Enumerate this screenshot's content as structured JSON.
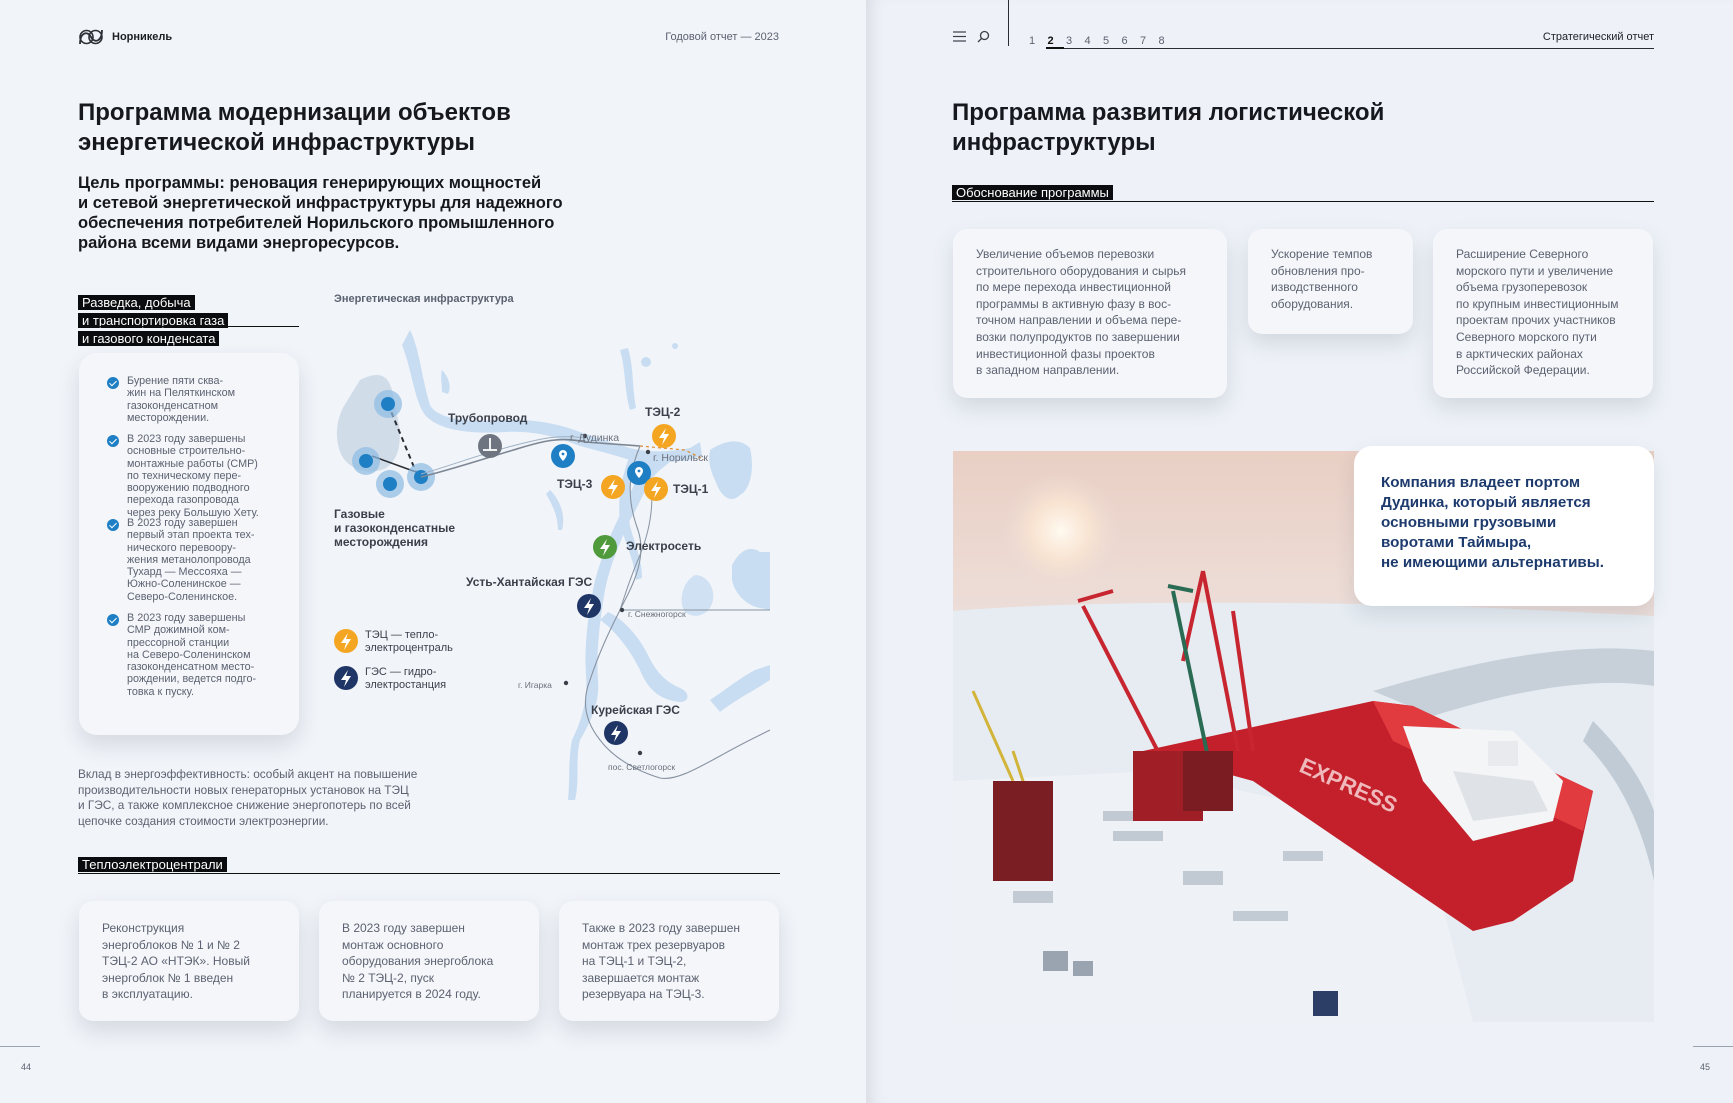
{
  "left": {
    "brand": "Норникель",
    "report_label": "Годовой отчет — 2023",
    "title": "Программа модернизации объектов\nэнергетической инфраструктуры",
    "goal": "Цель программы: реновация генерирующих мощностей\nи сетевой энергетической инфраструктуры для надежного\nобеспечения потребителей Норильского промышленного\nрайона всеми видами энергоресурсов.",
    "gas_section": {
      "tag": "Разведка, добыча\nи транспортировка газа\nи газового конденсата",
      "items": [
        "Бурение пяти сква-\nжин на Пеляткинском\nгазоконденсатном\nместорождении.",
        "В 2023 году завершены\nосновные строительно-\nмонтажные работы (СМР)\nпо техническому пере-\nвооружению подводного\nперехода газопровода\nчерез реку Большую Хету.",
        "В 2023 году завершен\nпервый этап проекта тех-\nнического перевоору-\nжения метанолопровода\nТухард — Мессояха —\nЮжно-Соленинское —\nСеверо-Соленинское.",
        "В 2023 году завершены\nСМР дожимной ком-\nпрессорной станции\nна Северо-Соленинском\nгазоконденсатном место-\nрождении, ведется подго-\nтовка к пуску."
      ]
    },
    "map": {
      "title": "Энергетическая инфраструктура",
      "labels": {
        "pipeline": "Трубопровод",
        "fields": "Газовые\nи газоконденсатные\nместорождения",
        "tec2": "ТЭЦ-2",
        "tec3": "ТЭЦ-3",
        "tec1": "ТЭЦ-1",
        "grid": "Электросеть",
        "ust": "Усть-Хантайская ГЭС",
        "kurei": "Курейская ГЭС"
      },
      "cities": {
        "dudinka": "г. Дудинка",
        "norilsk": "г. Норильск",
        "snezhnogorsk": "г. Снежногорск",
        "igarka": "г. Игарка",
        "svetlogorsk": "пос. Светлогорск"
      },
      "legend": {
        "tec": "ТЭЦ — тепло-\nэлектроцентраль",
        "ges": "ГЭС — гидро-\nэлектростанция"
      },
      "icons": {
        "tec": "lightning-icon",
        "ges": "lightning-icon",
        "city": "location-pin-icon",
        "pipeline": "pipeline-icon"
      },
      "colors": {
        "tec": "#f4a623",
        "ges": "#1f3566",
        "grid": "#4f9a3b",
        "pin": "#1f7fc4",
        "water": "#c9ddf2"
      }
    },
    "efficiency_note": "Вклад в энергоэффективность: особый акцент на повышение\nпроизводительности новых генераторных установок на ТЭЦ\nи ГЭС, а также комплексное снижение энергопотерь по всей\nцепочке создания стоимости электроэнергии.",
    "tec_section": {
      "tag": "Теплоэлектроцентрали",
      "cards": [
        "Реконструкция\nэнергоблоков № 1 и № 2\nТЭЦ-2 АО «НТЭК». Новый\nэнергоблок № 1 введен\nв эксплуатацию.",
        "В 2023 году завершен\nмонтаж основного\nоборудования энергоблока\n№ 2 ТЭЦ-2, пуск\nпланируется в 2024 году.",
        "Также в 2023 году завершен\nмонтаж трех резервуаров\nна ТЭЦ-1 и ТЭЦ-2,\nзавершается монтаж\nрезервуара на ТЭЦ-3."
      ]
    },
    "page_number": "44"
  },
  "right": {
    "nav": {
      "menu_icon": "menu-icon",
      "search_icon": "search-icon",
      "pages": [
        "1",
        "2",
        "3",
        "4",
        "5",
        "6",
        "7",
        "8"
      ],
      "active_page": "2",
      "section_label": "Стратегический отчет"
    },
    "title": "Программа развития логистической\nинфраструктуры",
    "rationale_tag": "Обоснование программы",
    "cards": [
      "Увеличение объемов перевозки\nстроительного оборудования и сырья\nпо мере перехода инвестиционной\nпрограммы в активную фазу в вос-\nточном направлении и объема пере-\nвозки полупродуктов по завершении\nинвестиционной фазы проектов\nв западном направлении.",
      "Ускорение темпов\nобновления про-\nизводственного\nоборудования.",
      "Расширение Северного\nморского пути и увеличение\nобъема грузоперевозок\nпо крупным инвестиционным\nпроектам прочих участников\nСеверного морского пути\nв арктических районах\nРоссийской Федерации."
    ],
    "quote": "Компания владеет портом\nДудинка, который является\nосновными грузовыми\nворотами Таймыра,\nне имеющими альтернативы.",
    "photo_ship_text": "EXPRESS",
    "page_number": "45"
  }
}
